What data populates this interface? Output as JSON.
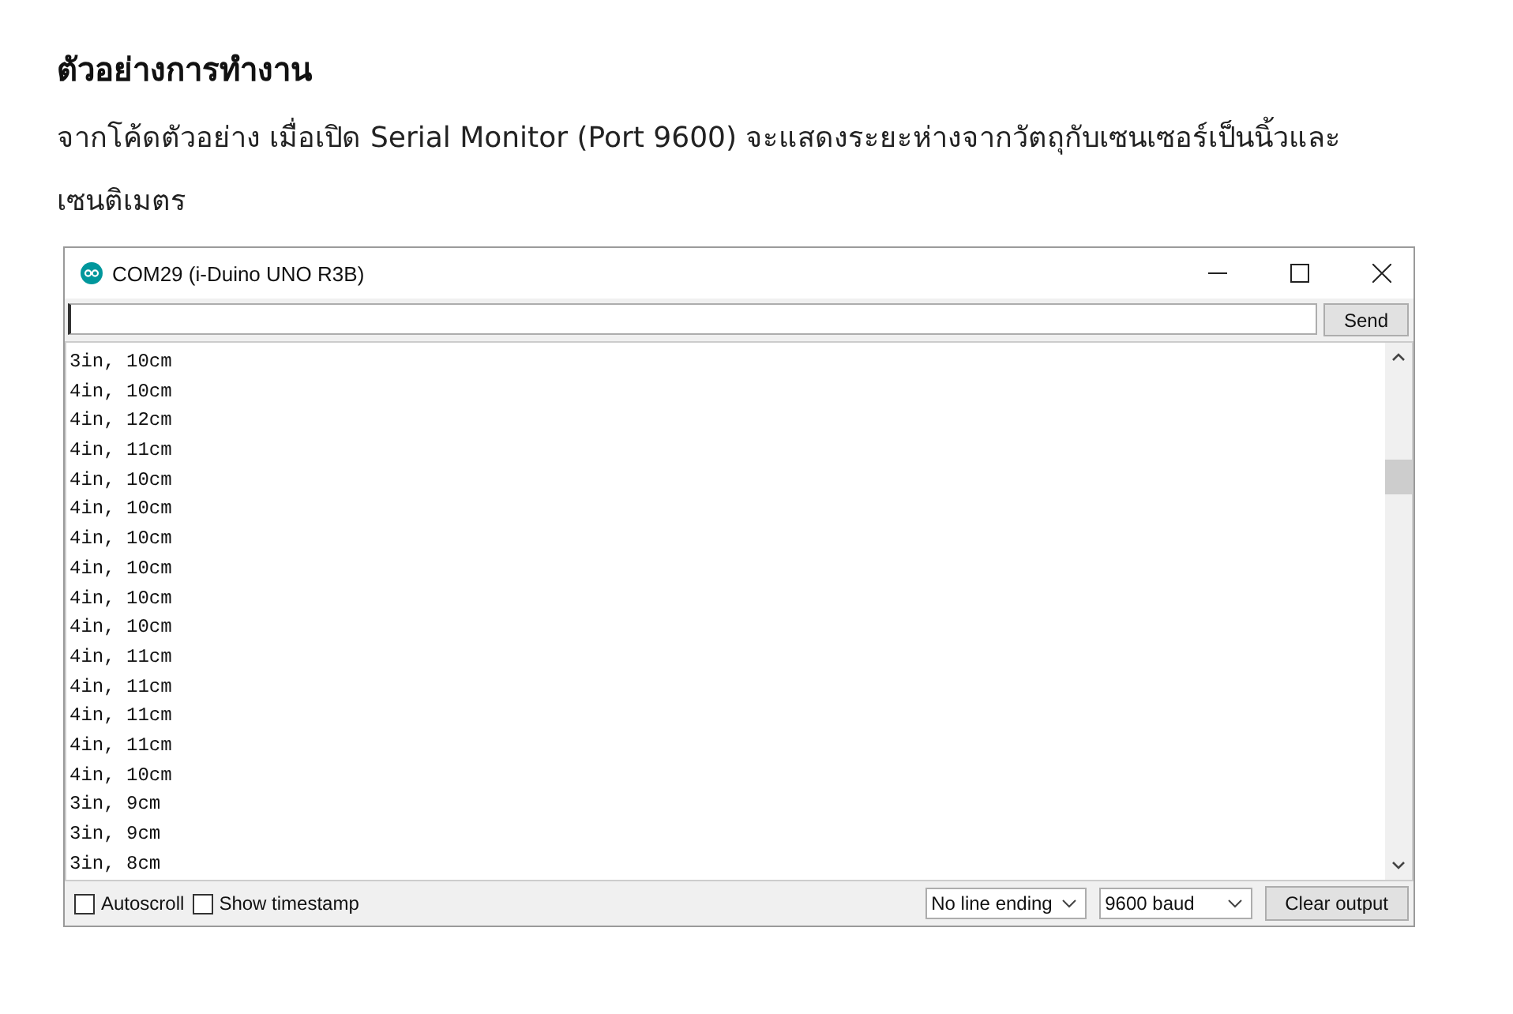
{
  "article": {
    "heading": "ตัวอย่างการทำงาน",
    "paragraph": "จากโค้ดตัวอย่าง เมื่อเปิด Serial Monitor (Port 9600) จะแสดงระยะห่างจากวัตถุกับเซนเซอร์เป็นนิ้วและเซนติเมตร"
  },
  "window": {
    "title": "COM29 (i-Duino UNO R3B)"
  },
  "send_button": "Send",
  "output_lines": [
    "3in, 10cm",
    "4in, 10cm",
    "4in, 12cm",
    "4in, 11cm",
    "4in, 10cm",
    "4in, 10cm",
    "4in, 10cm",
    "4in, 10cm",
    "4in, 10cm",
    "4in, 10cm",
    "4in, 11cm",
    "4in, 11cm",
    "4in, 11cm",
    "4in, 11cm",
    "4in, 10cm",
    "3in, 9cm",
    "3in, 9cm",
    "3in, 8cm"
  ],
  "options": [
    {
      "label": "Autoscroll",
      "checked": false
    },
    {
      "label": "Show timestamp",
      "checked": false
    }
  ],
  "line_ending": "No line ending",
  "baud": "9600 baud",
  "clear_button": "Clear output"
}
